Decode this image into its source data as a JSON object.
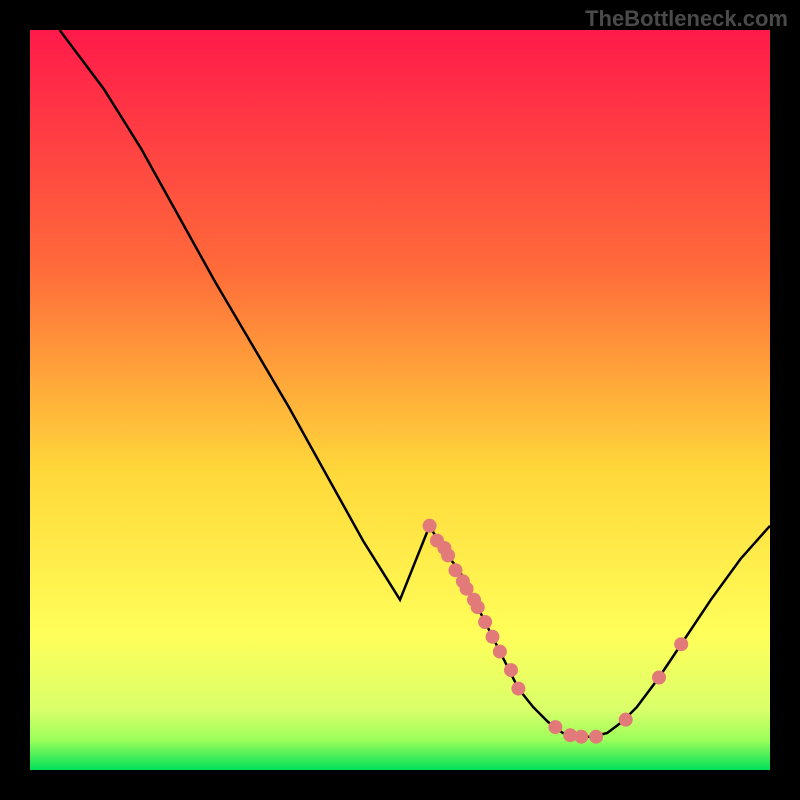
{
  "attribution": "TheBottleneck.com",
  "chart_data": {
    "type": "line",
    "title": "",
    "xlabel": "",
    "ylabel": "",
    "xlim": [
      0,
      100
    ],
    "ylim": [
      0,
      100
    ],
    "gradient_colors": {
      "top": "#ff1a4a",
      "upper_mid": "#ff6a3a",
      "mid": "#ffd93a",
      "lower_mid": "#ffff5a",
      "bottom_band": "#9aff5a",
      "bottom": "#00e05a"
    },
    "curve": [
      {
        "x": 4,
        "y": 100
      },
      {
        "x": 10,
        "y": 92
      },
      {
        "x": 15,
        "y": 84
      },
      {
        "x": 20,
        "y": 75
      },
      {
        "x": 25,
        "y": 66
      },
      {
        "x": 30,
        "y": 57.5
      },
      {
        "x": 35,
        "y": 49
      },
      {
        "x": 40,
        "y": 40
      },
      {
        "x": 45,
        "y": 31
      },
      {
        "x": 50,
        "y": 23
      },
      {
        "x": 54,
        "y": 33
      },
      {
        "x": 56,
        "y": 29.5
      },
      {
        "x": 58,
        "y": 27
      },
      {
        "x": 60,
        "y": 23
      },
      {
        "x": 62,
        "y": 19
      },
      {
        "x": 64,
        "y": 15
      },
      {
        "x": 66,
        "y": 11
      },
      {
        "x": 68,
        "y": 8.5
      },
      {
        "x": 70,
        "y": 6.5
      },
      {
        "x": 72,
        "y": 5
      },
      {
        "x": 74,
        "y": 4.5
      },
      {
        "x": 76,
        "y": 4.5
      },
      {
        "x": 78,
        "y": 5
      },
      {
        "x": 80,
        "y": 6.5
      },
      {
        "x": 82,
        "y": 8.5
      },
      {
        "x": 85,
        "y": 12.5
      },
      {
        "x": 88,
        "y": 17
      },
      {
        "x": 92,
        "y": 23
      },
      {
        "x": 96,
        "y": 28.5
      },
      {
        "x": 100,
        "y": 33
      }
    ],
    "markers": [
      {
        "x": 54,
        "y": 33
      },
      {
        "x": 55,
        "y": 31
      },
      {
        "x": 56,
        "y": 30
      },
      {
        "x": 56.5,
        "y": 29
      },
      {
        "x": 57.5,
        "y": 27
      },
      {
        "x": 58.5,
        "y": 25.5
      },
      {
        "x": 59,
        "y": 24.5
      },
      {
        "x": 60,
        "y": 23
      },
      {
        "x": 60.5,
        "y": 22
      },
      {
        "x": 61.5,
        "y": 20
      },
      {
        "x": 62.5,
        "y": 18
      },
      {
        "x": 63.5,
        "y": 16
      },
      {
        "x": 65,
        "y": 13.5
      },
      {
        "x": 66,
        "y": 11
      },
      {
        "x": 71,
        "y": 5.8
      },
      {
        "x": 73,
        "y": 4.7
      },
      {
        "x": 74.5,
        "y": 4.5
      },
      {
        "x": 76.5,
        "y": 4.5
      },
      {
        "x": 80.5,
        "y": 6.8
      },
      {
        "x": 85,
        "y": 12.5
      },
      {
        "x": 88,
        "y": 17
      }
    ],
    "marker_color": "#e27a7a",
    "marker_radius": 7,
    "line_color": "#000000",
    "line_width": 2.5
  }
}
